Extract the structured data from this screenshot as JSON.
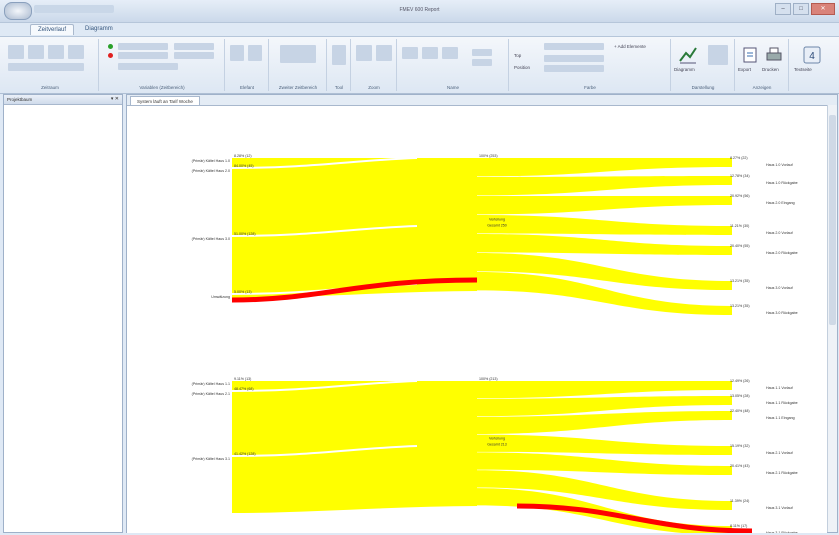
{
  "window": {
    "title": "FMEV 600 Report",
    "buttons": [
      "–",
      "□",
      "✕"
    ]
  },
  "tabs": [
    {
      "label": "Zeitverlauf",
      "active": true
    },
    {
      "label": "Diagramm",
      "active": false
    }
  ],
  "ribbon": {
    "groups": [
      {
        "name": "Zeitraum"
      },
      {
        "name": "Variablen (Zeitbereich)"
      },
      {
        "name": "Elefant"
      },
      {
        "name": "Zweiter Zeitbereich"
      },
      {
        "name": "Tool"
      },
      {
        "name": "Zoom"
      },
      {
        "name": "Name"
      },
      {
        "name": "Farbe"
      },
      {
        "name": "Darstellung"
      },
      {
        "name": "Anzeigen"
      }
    ],
    "fields": {
      "top_label": "Top",
      "position_label": "Position",
      "add_elements": "+ Add Elemente"
    },
    "big_buttons": {
      "diagramm": "Diagramm",
      "export": "Export",
      "drucken": "Drucken",
      "textseite": "Textseite"
    }
  },
  "left_pane": {
    "title": "Projektbaum"
  },
  "document": {
    "tab_label": "System läuft an Tarif Woche"
  },
  "colors": {
    "flow": "#ffff00",
    "highlight": "#ff0000",
    "ribbon_bg": "#dde7f3"
  },
  "chart_data": {
    "type": "sankey",
    "diagrams": [
      {
        "sources": [
          {
            "label": "(Primär) Kältel Haus 1.0"
          },
          {
            "label": "(Primär) Kältel Haus 2.0"
          },
          {
            "label": "(Primär) Kältel Haus 3.0"
          },
          {
            "label": "Umwälzung"
          }
        ],
        "source_values": [
          "8.28% (12)",
          "84.00% (45)",
          "51.00% (128)",
          "5.00% (13)"
        ],
        "middle_value": "100% (253)",
        "middle_label": "Verteilung",
        "middle_sub": "Gesamt 250",
        "targets": [
          {
            "label": "Haus 1.0 Vorlauf",
            "value": "8.27% (22)"
          },
          {
            "label": "Haus 1.0 Rückgabe",
            "value": "12.78% (34)"
          },
          {
            "label": "Haus 2.0 Eingang",
            "value": "20.92% (56)"
          },
          {
            "label": "Haus 2.0 Vorlauf",
            "value": "11.21% (30)"
          },
          {
            "label": "Haus 2.0 Rückgabe",
            "value": "20.40% (55)"
          },
          {
            "label": "Haus 3.0 Vorlauf",
            "value": "13.21% (35)"
          },
          {
            "label": "Haus 3.0 Rückgabe",
            "value": "13.21% (35)"
          }
        ]
      },
      {
        "sources": [
          {
            "label": "(Primär) Kältel Haus 1.1"
          },
          {
            "label": "(Primär) Kältel Haus 2.1"
          },
          {
            "label": "(Primär) Kältel Haus 3.1"
          }
        ],
        "source_values": [
          "9.11% (13)",
          "48.47% (68)",
          "41.42% (128)"
        ],
        "middle_value": "100% (213)",
        "middle_label": "Verteilung",
        "middle_sub": "Gesamt 213",
        "targets": [
          {
            "label": "Haus 1.1 Vorlauf",
            "value": "12.49% (26)"
          },
          {
            "label": "Haus 1.1 Rückgabe",
            "value": "13.05% (28)"
          },
          {
            "label": "Haus 1.1 Eingang",
            "value": "22.40% (48)"
          },
          {
            "label": "Haus 2.1 Vorlauf",
            "value": "15.19% (32)"
          },
          {
            "label": "Haus 2.1 Rückgabe",
            "value": "20.41% (43)"
          },
          {
            "label": "Haus 3.1 Vorlauf",
            "value": "11.39% (24)"
          },
          {
            "label": "Haus 3.1 Rückgabe",
            "value": "8.11% (17)"
          }
        ]
      }
    ]
  }
}
